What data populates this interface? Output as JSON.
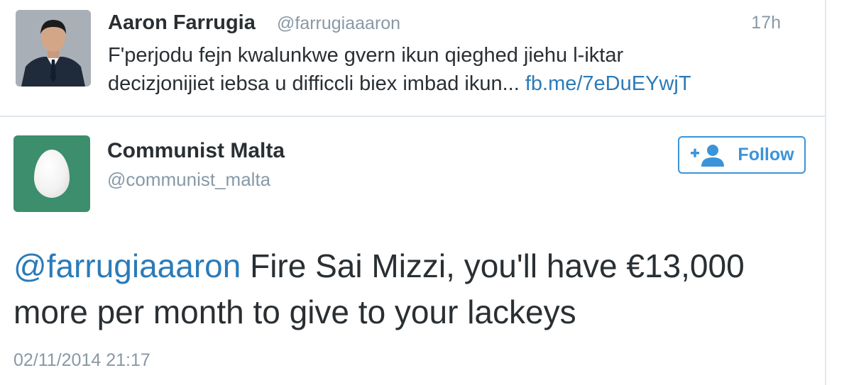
{
  "reply_context_tweet": {
    "author_name": "Aaron Farrugia",
    "author_handle": "@farrugiaaaron",
    "time_ago": "17h",
    "text": "F'perjodu fejn kwalunkwe gvern ikun qieghed jiehu l-iktar",
    "text_line2": "decizjonijiet iebsa u difficcli biex imbad ikun... ",
    "link": "fb.me/7eDuEYwjT",
    "avatar_icon": "profile-photo"
  },
  "main_tweet": {
    "author_name": "Communist Malta",
    "author_handle": "@communist_malta",
    "avatar_icon": "default-egg-avatar",
    "avatar_color": "#3c8e6c",
    "follow_button_label": "Follow",
    "mention": "@farrugiaaaron",
    "text": " Fire Sai Mizzi, you'll have €13,000 more per month to give to your lackeys",
    "timestamp": "02/11/2014 21:17"
  },
  "colors": {
    "link": "#2b7bb9",
    "accent": "#3b94d9",
    "muted": "#8899a6",
    "text": "#292f33",
    "divider": "#e1e8ed"
  }
}
